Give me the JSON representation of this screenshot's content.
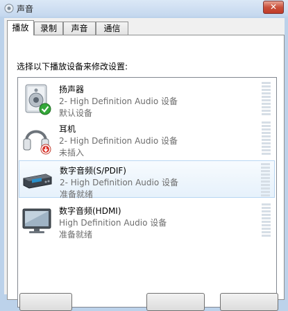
{
  "window": {
    "title": "声音"
  },
  "tabs": [
    {
      "label": "播放",
      "active": true
    },
    {
      "label": "录制",
      "active": false
    },
    {
      "label": "声音",
      "active": false
    },
    {
      "label": "通信",
      "active": false
    }
  ],
  "instruction": "选择以下播放设备来修改设置:",
  "devices": [
    {
      "name": "扬声器",
      "description": "2- High Definition Audio 设备",
      "status": "默认设备",
      "icon": "speaker-icon",
      "badge": "default-check"
    },
    {
      "name": "耳机",
      "description": "2- High Definition Audio 设备",
      "status": "未插入",
      "icon": "headphones-icon",
      "badge": "unplugged"
    },
    {
      "name": "数字音频(S/PDIF)",
      "description": "2- High Definition Audio 设备",
      "status": "准备就绪",
      "icon": "spdif-device-icon",
      "selected": true
    },
    {
      "name": "数字音频(HDMI)",
      "description": "High Definition Audio 设备",
      "status": "准备就绪",
      "icon": "monitor-icon"
    }
  ]
}
